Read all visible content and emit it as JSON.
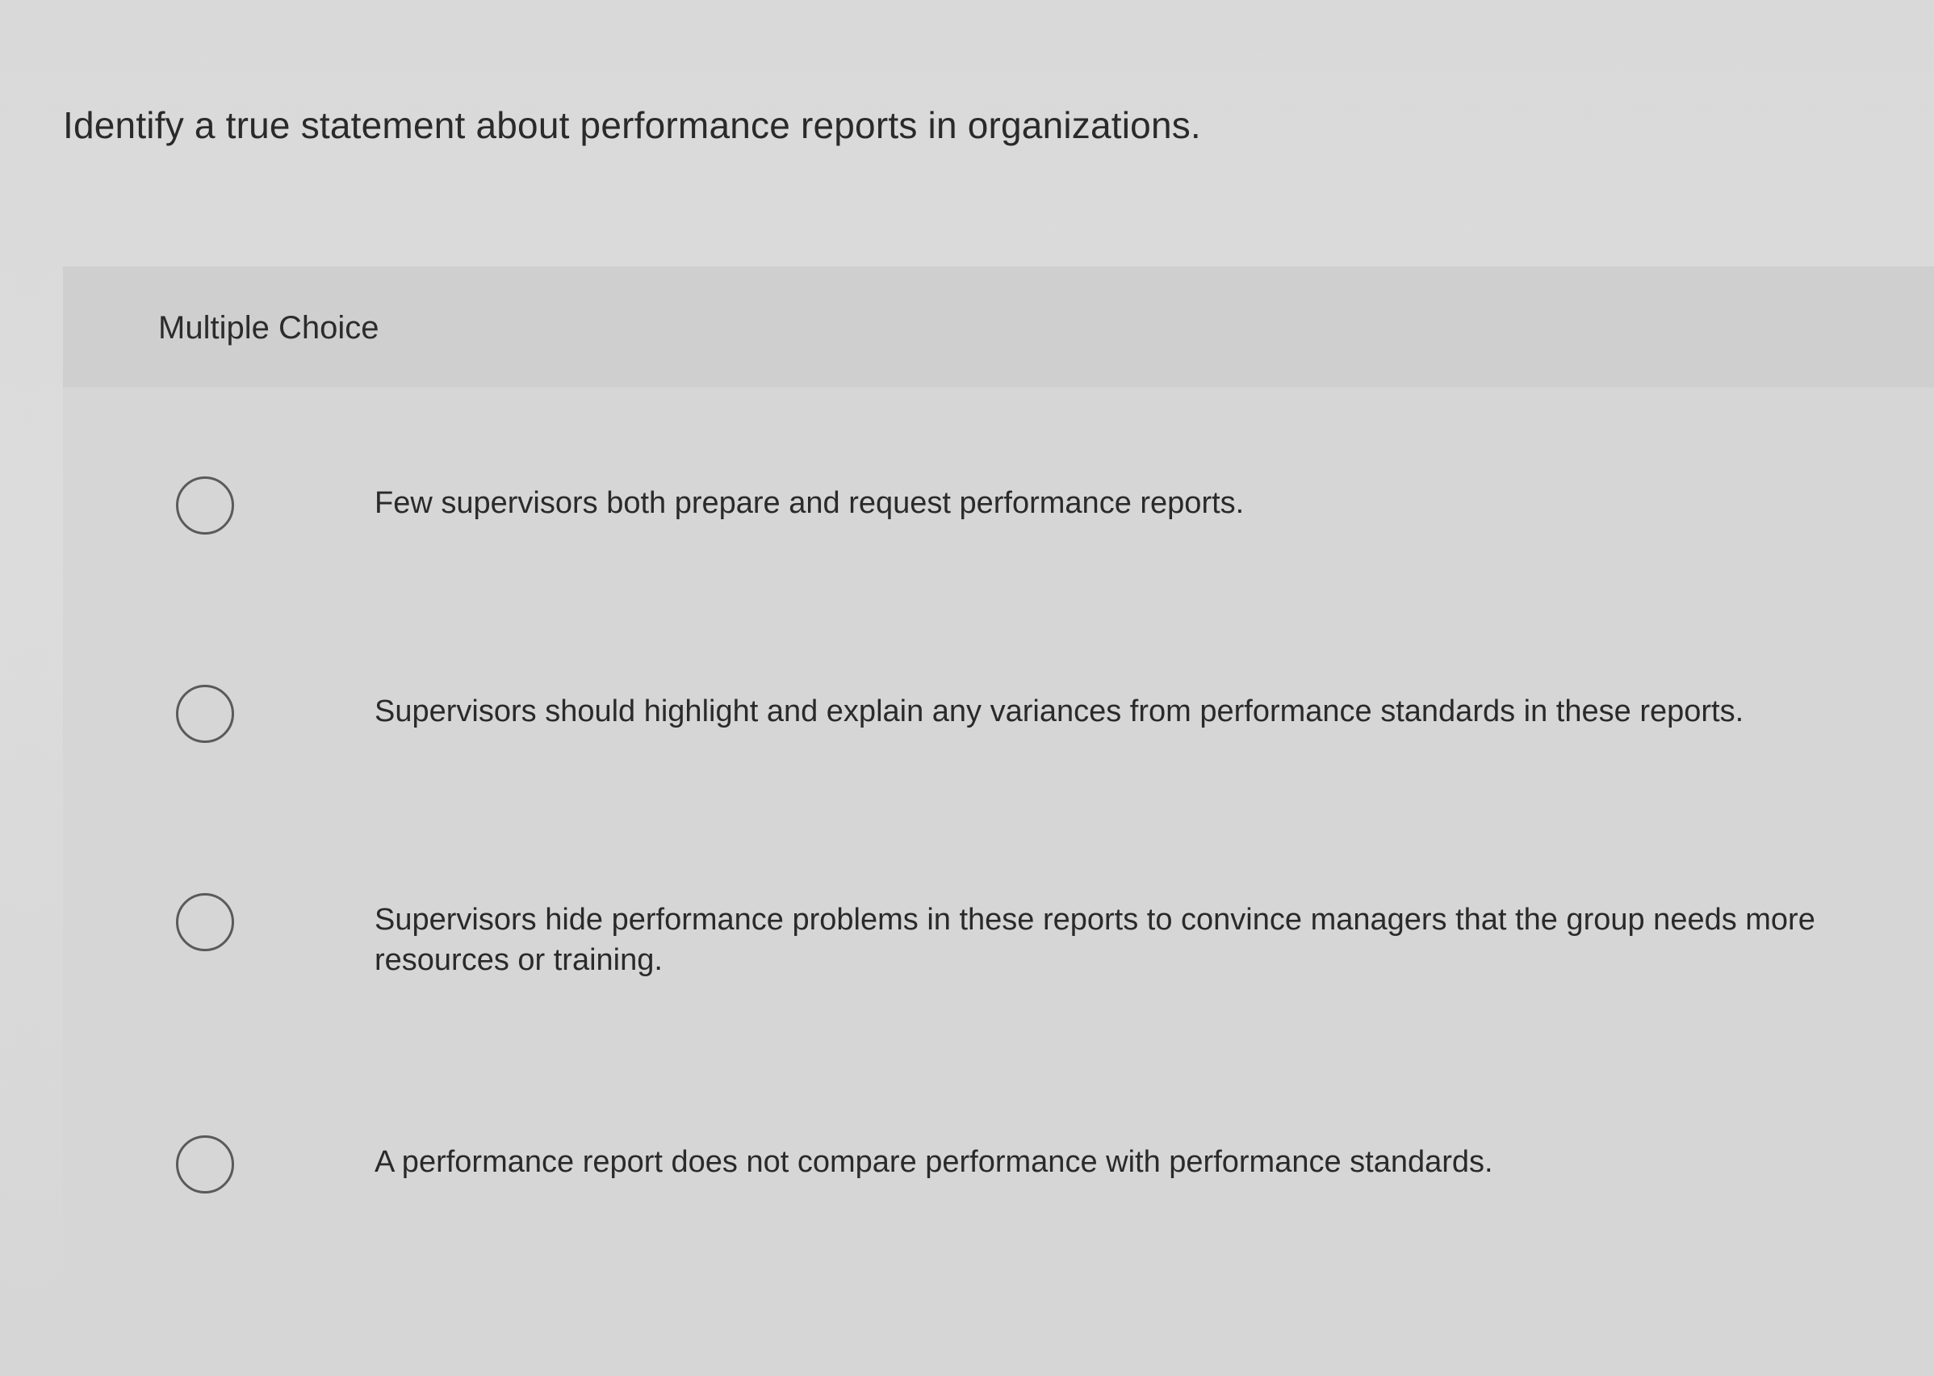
{
  "question": {
    "text": "Identify a true statement about performance reports in organizations."
  },
  "card": {
    "header_label": "Multiple Choice"
  },
  "options": [
    {
      "label": "Few supervisors both prepare and request performance reports."
    },
    {
      "label": "Supervisors should highlight and explain any variances from performance standards in these reports."
    },
    {
      "label": "Supervisors hide performance problems in these reports to convince managers that the group needs more resources or training."
    },
    {
      "label": "A performance report does not compare performance with performance standards."
    }
  ]
}
